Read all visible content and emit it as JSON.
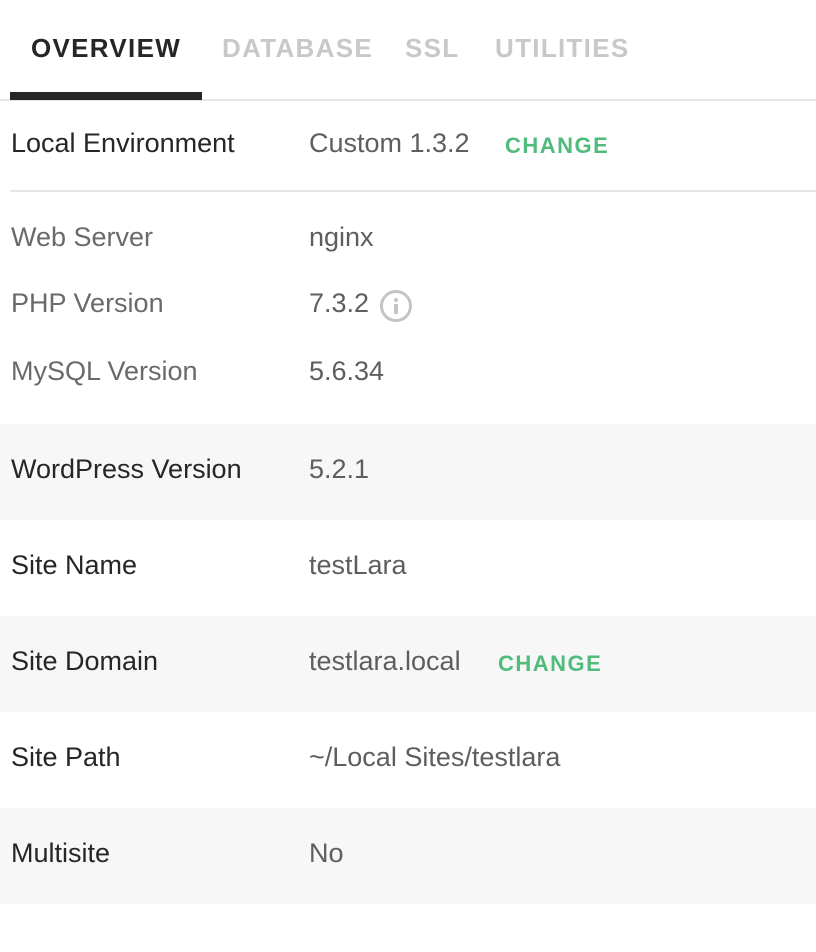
{
  "tabs": [
    {
      "label": "OVERVIEW",
      "active": true
    },
    {
      "label": "DATABASE",
      "active": false
    },
    {
      "label": "SSL",
      "active": false
    },
    {
      "label": "UTILITIES",
      "active": false
    }
  ],
  "local_environment": {
    "label": "Local Environment",
    "value": "Custom 1.3.2",
    "change_label": "CHANGE"
  },
  "environment_details": [
    {
      "label": "Web Server",
      "value": "nginx"
    },
    {
      "label": "PHP Version",
      "value": "7.3.2",
      "icon": "info-icon"
    },
    {
      "label": "MySQL Version",
      "value": "5.6.34"
    }
  ],
  "site_details": [
    {
      "label": "WordPress Version",
      "value": "5.2.1"
    },
    {
      "label": "Site Name",
      "value": "testLara"
    },
    {
      "label": "Site Domain",
      "value": "testlara.local",
      "change_label": "CHANGE"
    },
    {
      "label": "Site Path",
      "value": "~/Local Sites/testlara"
    },
    {
      "label": "Multisite",
      "value": "No"
    }
  ],
  "colors": {
    "accent_green": "#51bb7b",
    "active_tab": "#262626",
    "inactive_tab": "#c8c8c8",
    "stripe_bg": "#f7f7f7"
  }
}
